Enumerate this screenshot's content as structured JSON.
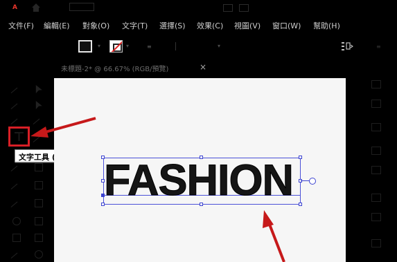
{
  "app": {
    "logo": "A"
  },
  "menu": [
    "文件(F)",
    "編輯(E)",
    "對象(O)",
    "文字(T)",
    "選擇(S)",
    "效果(C)",
    "視圖(V)",
    "窗口(W)",
    "幫助(H)"
  ],
  "document": {
    "tab_label": "未標題-2* @ 66.67% (RGB/預覽)",
    "close_glyph": "×"
  },
  "tooltip": {
    "text": "文字工具 (T)"
  },
  "canvas": {
    "headline": "FASHION"
  },
  "colors": {
    "annotation": "#c6191a",
    "selection": "#3c43d0",
    "canvas": "#f6f6f6"
  }
}
